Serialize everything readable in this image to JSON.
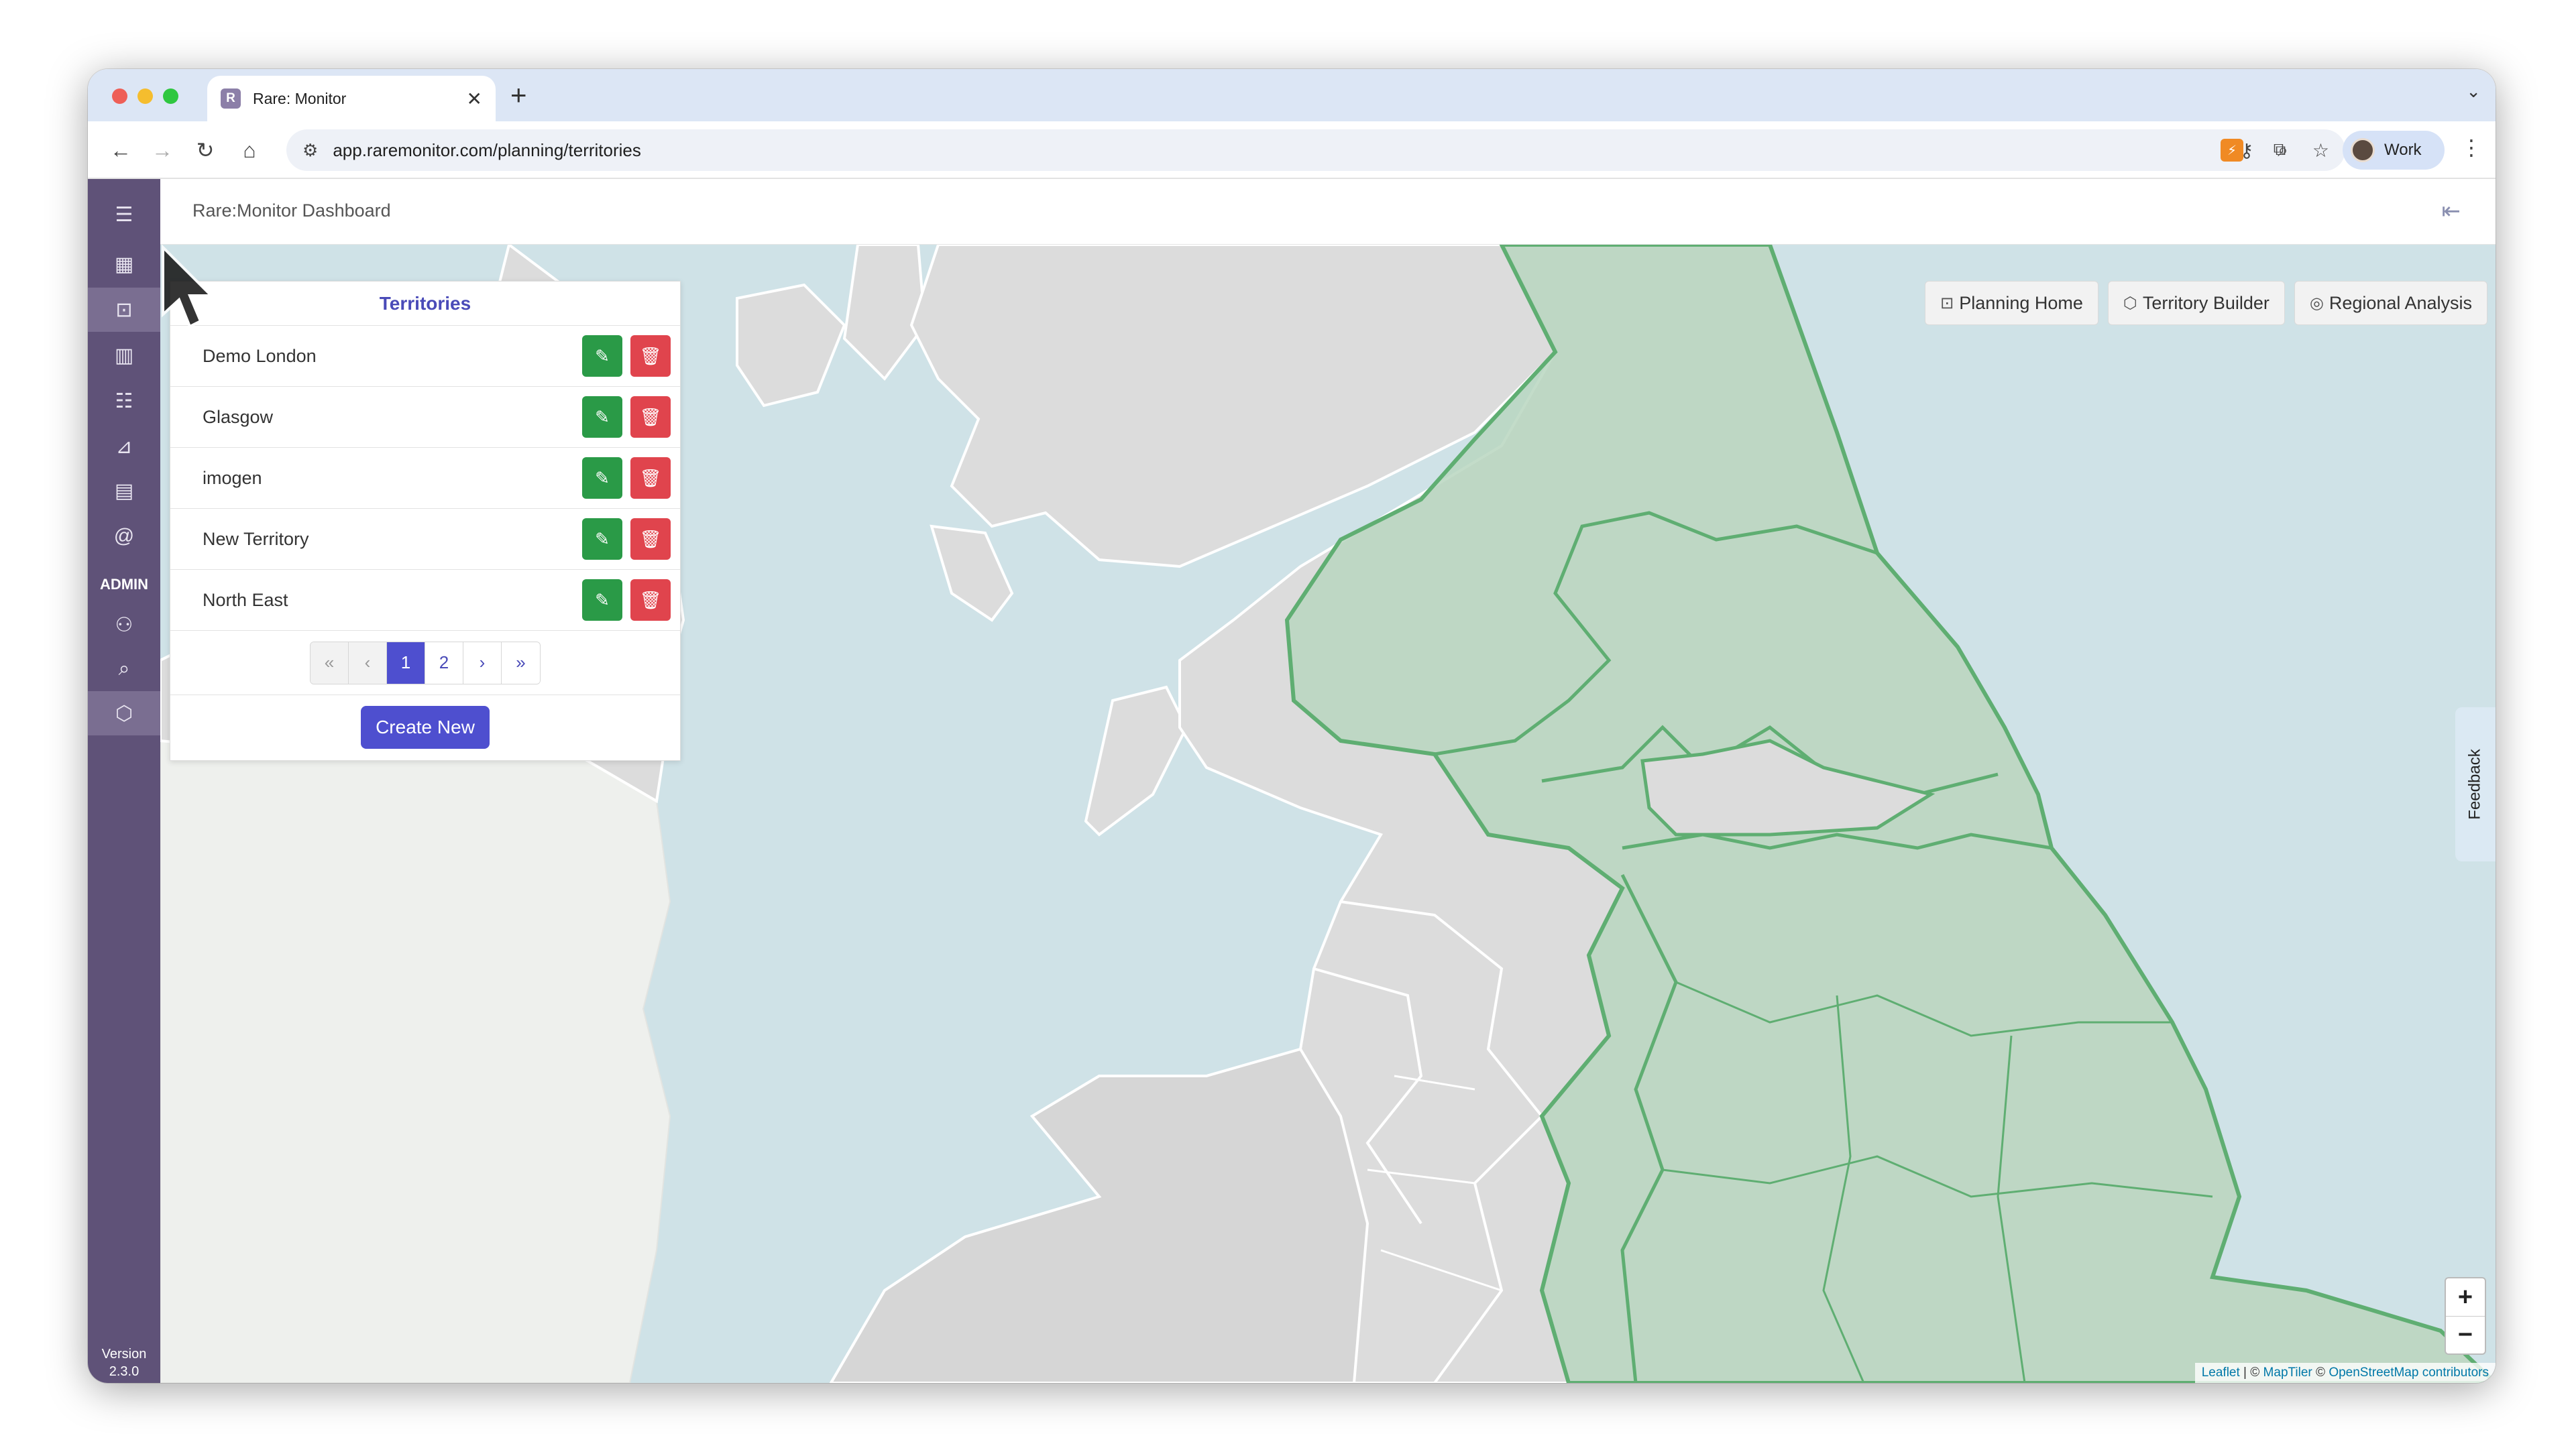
{
  "browser": {
    "tab_title": "Rare: Monitor",
    "tab_favicon": "R",
    "url": "app.raremonitor.com/planning/territories",
    "profile_name": "Work"
  },
  "app": {
    "title": "Rare:Monitor Dashboard",
    "admin_label": "ADMIN",
    "version_label": "Version",
    "version_number": "2.3.0"
  },
  "panel": {
    "title": "Territories",
    "territories": [
      {
        "name": "Demo London"
      },
      {
        "name": "Glasgow"
      },
      {
        "name": "imogen"
      },
      {
        "name": "New Territory"
      },
      {
        "name": "North East"
      }
    ],
    "pagination": {
      "first": "«",
      "prev": "‹",
      "pages": [
        "1",
        "2"
      ],
      "current": "1",
      "next": "›",
      "last": "»"
    },
    "create_label": "Create New"
  },
  "map_buttons": {
    "planning_home": "Planning Home",
    "territory_builder": "Territory Builder",
    "regional_analysis": "Regional Analysis"
  },
  "feedback_label": "Feedback",
  "zoom": {
    "in": "+",
    "out": "−"
  },
  "attribution": {
    "leaflet": "Leaflet",
    "sep1": " | © ",
    "maptiler": "MapTiler",
    "sep2": " © ",
    "osm": "OpenStreetMap contributors"
  },
  "colors": {
    "sidebar": "#5f5278",
    "accent": "#4e4fcf",
    "edit": "#2a9a47",
    "delete": "#e0444d",
    "sea": "#cfe2e7",
    "land": "#dcdcdc",
    "territory": "#b9d6c0",
    "territory_border": "#5fae72"
  },
  "icons": {
    "menu": "hamburger-icon",
    "edit": "pencil-icon",
    "delete": "trash-icon",
    "exit": "logout-icon"
  }
}
